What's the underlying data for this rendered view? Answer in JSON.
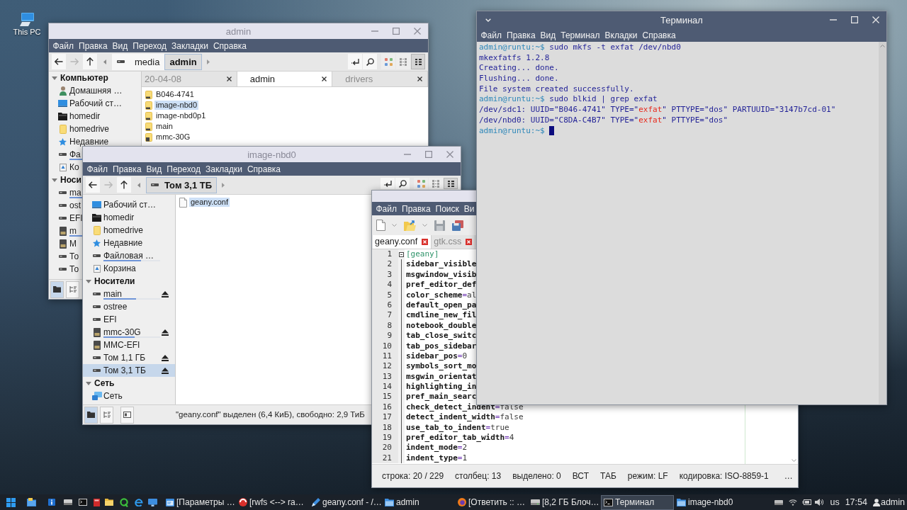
{
  "desktop_icons": [
    {
      "label": "This PC"
    }
  ],
  "windows": [
    {
      "kind": "file_manager",
      "title": "admin",
      "active": false,
      "menu": [
        "Файл",
        "Правка",
        "Вид",
        "Переход",
        "Закладки",
        "Справка"
      ],
      "nav": [
        {
          "kind": "back",
          "disabled": false
        },
        {
          "kind": "forward",
          "disabled": true
        },
        {
          "kind": "up",
          "disabled": false
        }
      ],
      "path": [
        {
          "kind": "root",
          "selected": false
        },
        {
          "kind": "folder",
          "label": "media",
          "selected": false
        },
        {
          "kind": "folder",
          "label": "admin",
          "selected": true
        }
      ],
      "view_modes": [
        {
          "kind": "icons",
          "selected": false
        },
        {
          "kind": "compact",
          "selected": false
        },
        {
          "kind": "details",
          "selected": true
        }
      ],
      "sidebar": [
        {
          "title": "Компьютер",
          "expanded": true,
          "children": [
            {
              "kind": "home",
              "label": "Домашняя …",
              "selected": false
            },
            {
              "kind": "desktop",
              "label": "Рабочий ст…",
              "selected": false
            },
            {
              "kind": "dark_folder",
              "label": "homedir",
              "selected": false
            },
            {
              "kind": "folder",
              "label": "homedrive",
              "selected": false
            },
            {
              "kind": "recent",
              "label": "Недавние",
              "selected": false
            },
            {
              "kind": "drive",
              "label": "Фа",
              "selected": false,
              "level": 0.66
            },
            {
              "kind": "trash",
              "label": "Ко",
              "selected": false
            }
          ]
        },
        {
          "title": "Носи",
          "expanded": true,
          "children": [
            {
              "kind": "drive",
              "label": "ma",
              "selected": false,
              "level": 0.58
            },
            {
              "kind": "drive",
              "label": "ost",
              "selected": false
            },
            {
              "kind": "drive",
              "label": "EFI",
              "selected": false
            },
            {
              "kind": "card",
              "label": "m",
              "selected": false,
              "level": 0.55
            },
            {
              "kind": "card",
              "label": "M",
              "selected": false
            },
            {
              "kind": "drive",
              "label": "То",
              "selected": false
            },
            {
              "kind": "drive",
              "label": "То",
              "selected": false
            }
          ]
        }
      ],
      "tabs": [
        {
          "label": "20-04-08",
          "selected": false
        },
        {
          "label": "admin",
          "selected": true
        },
        {
          "label": "drivers",
          "selected": false
        }
      ],
      "files": [
        {
          "kind": "mount",
          "name": "B046-4741",
          "selected": false
        },
        {
          "kind": "mount",
          "name": "image-nbd0",
          "selected": true
        },
        {
          "kind": "mount",
          "name": "image-nbd0p1",
          "selected": false
        },
        {
          "kind": "mount",
          "name": "main",
          "selected": false
        },
        {
          "kind": "card_mount",
          "name": "mmc-30G",
          "selected": false
        }
      ],
      "panel_buttons": [
        {
          "kind": "places",
          "selected": true
        },
        {
          "kind": "tree",
          "selected": false
        }
      ]
    },
    {
      "kind": "file_manager",
      "title": "image-nbd0",
      "active": false,
      "menu": [
        "Файл",
        "Правка",
        "Вид",
        "Переход",
        "Закладки",
        "Справка"
      ],
      "nav": [
        {
          "kind": "back",
          "disabled": false
        },
        {
          "kind": "forward",
          "disabled": true
        },
        {
          "kind": "up",
          "disabled": false
        }
      ],
      "path": [
        {
          "kind": "drive",
          "label": "Том 3,1 ТБ",
          "selected": true
        }
      ],
      "view_modes": [
        {
          "kind": "icons",
          "selected": false
        },
        {
          "kind": "compact",
          "selected": false
        },
        {
          "kind": "details",
          "selected": true
        }
      ],
      "sidebar": [
        {
          "children": [
            {
              "kind": "desktop",
              "label": "Рабочий ст…",
              "selected": false,
              "ejectable": false
            },
            {
              "kind": "dark_folder",
              "label": "homedir",
              "selected": false,
              "ejectable": false
            },
            {
              "kind": "folder",
              "label": "homedrive",
              "selected": false,
              "ejectable": false
            },
            {
              "kind": "recent",
              "label": "Недавние",
              "selected": false,
              "ejectable": false
            },
            {
              "kind": "drive",
              "label": "Файловая …",
              "selected": false,
              "ejectable": false,
              "level": 0.66
            },
            {
              "kind": "trash",
              "label": "Корзина",
              "selected": false,
              "ejectable": false
            }
          ]
        },
        {
          "title": "Носители",
          "expanded": true,
          "children": [
            {
              "kind": "drive",
              "label": "main",
              "selected": false,
              "ejectable": true,
              "level": 0.58
            },
            {
              "kind": "drive",
              "label": "ostree",
              "selected": false,
              "ejectable": false
            },
            {
              "kind": "drive",
              "label": "EFI",
              "selected": false,
              "ejectable": false
            },
            {
              "kind": "card",
              "label": "mmc-30G",
              "selected": false,
              "ejectable": true,
              "level": 0.55
            },
            {
              "kind": "card",
              "label": "MMC-EFI",
              "selected": false,
              "ejectable": false
            },
            {
              "kind": "drive",
              "label": "Том 1,1 ГБ",
              "selected": false,
              "ejectable": true
            },
            {
              "kind": "drive",
              "label": "Том 3,1 ТБ",
              "selected": true,
              "ejectable": true
            }
          ]
        },
        {
          "title": "Сеть",
          "expanded": true,
          "children": [
            {
              "kind": "network",
              "label": "Сеть",
              "selected": false,
              "ejectable": false
            }
          ]
        }
      ],
      "files": [
        {
          "kind": "text",
          "name": "geany.conf",
          "selected": true
        }
      ],
      "panel_buttons": [
        {
          "kind": "places",
          "selected": true
        },
        {
          "kind": "tree",
          "selected": false
        },
        {
          "kind": "panel",
          "selected": false
        }
      ],
      "status": "\"geany.conf\" выделен (6,4 КиБ), свободно: 2,9 ТиБ"
    },
    {
      "kind": "editor",
      "active": false,
      "menu": [
        "Файл",
        "Правка",
        "Поиск",
        "Ви"
      ],
      "toolbar": [
        {
          "kind": "new",
          "disabled": false
        },
        {
          "kind": "open",
          "disabled": false
        },
        {
          "kind": "save",
          "disabled": true
        },
        {
          "kind": "save_all",
          "disabled": false
        }
      ],
      "tabs": [
        {
          "label": "geany.conf",
          "selected": true
        },
        {
          "label": "gtk.css",
          "selected": false
        }
      ],
      "lines": [
        {
          "number": "1",
          "kind": "section",
          "text": "[geany]"
        },
        {
          "number": "2",
          "kind": "entry",
          "key": "sidebar_visible"
        },
        {
          "number": "3",
          "kind": "entry",
          "key": "msgwindow_visib"
        },
        {
          "number": "4",
          "kind": "entry",
          "key": "pref_editor_def"
        },
        {
          "number": "5",
          "kind": "entry",
          "key": "color_scheme",
          "operator": "=",
          "value": "al"
        },
        {
          "number": "6",
          "kind": "entry",
          "key": "default_open_pa"
        },
        {
          "number": "7",
          "kind": "entry",
          "key": "cmdline_new_fil"
        },
        {
          "number": "8",
          "kind": "entry",
          "key": "notebook_double"
        },
        {
          "number": "9",
          "kind": "entry",
          "key": "tab_close_switc"
        },
        {
          "number": "10",
          "kind": "entry",
          "key": "tab_pos_sidebar"
        },
        {
          "number": "11",
          "kind": "entry",
          "key": "sidebar_pos",
          "operator": "=",
          "value": "0"
        },
        {
          "number": "12",
          "kind": "entry",
          "key": "symbols_sort_mo"
        },
        {
          "number": "13",
          "kind": "entry",
          "key": "msgwin_orientat"
        },
        {
          "number": "14",
          "kind": "entry",
          "key": "highlighting_in"
        },
        {
          "number": "15",
          "kind": "entry",
          "key": "pref_main_searc"
        },
        {
          "number": "16",
          "kind": "entry",
          "key": "check_detect_indent",
          "operator": "=",
          "value": "false"
        },
        {
          "number": "17",
          "kind": "entry",
          "key": "detect_indent_width",
          "operator": "=",
          "value": "false"
        },
        {
          "number": "18",
          "kind": "entry",
          "key": "use_tab_to_indent",
          "operator": "=",
          "value": "true"
        },
        {
          "number": "19",
          "kind": "entry",
          "key": "pref_editor_tab_width",
          "operator": "=",
          "value": "4"
        },
        {
          "number": "20",
          "kind": "entry",
          "key": "indent_mode",
          "operator": "=",
          "value": "2"
        },
        {
          "number": "21",
          "kind": "entry",
          "key": "indent_type",
          "operator": "=",
          "value": "1"
        }
      ],
      "status": [
        "строка: 20 / 229",
        "столбец: 13",
        "выделено: 0",
        "ВСТ",
        "ТАБ",
        "режим: LF",
        "кодировка: ISO-8859-1",
        "…"
      ]
    },
    {
      "kind": "terminal",
      "title": "Терминал",
      "active": true,
      "menu": [
        "Файл",
        "Правка",
        "Вид",
        "Терминал",
        "Вкладки",
        "Справка"
      ],
      "lines": [
        {
          "segments": [
            {
              "kind": "prompt",
              "text": "admin@runtu:~$"
            },
            {
              "kind": "text",
              "text": " sudo mkfs -t exfat /dev/nbd0"
            }
          ],
          "cursor": false
        },
        {
          "segments": [
            {
              "kind": "text",
              "text": "mkexfatfs 1.2.8"
            }
          ],
          "cursor": false
        },
        {
          "segments": [
            {
              "kind": "text",
              "text": "Creating... done."
            }
          ],
          "cursor": false
        },
        {
          "segments": [
            {
              "kind": "text",
              "text": "Flushing... done."
            }
          ],
          "cursor": false
        },
        {
          "segments": [
            {
              "kind": "text",
              "text": "File system created successfully."
            }
          ],
          "cursor": false
        },
        {
          "segments": [
            {
              "kind": "prompt",
              "text": "admin@runtu:~$"
            },
            {
              "kind": "text",
              "text": " sudo blkid | grep exfat"
            }
          ],
          "cursor": false
        },
        {
          "segments": [
            {
              "kind": "text",
              "text": "/dev/sdc1: UUID=\"B046-4741\" TYPE=\""
            },
            {
              "kind": "match",
              "text": "exfat"
            },
            {
              "kind": "text",
              "text": "\" PTTYPE=\"dos\" PARTUUID=\"3147b7cd-01\""
            }
          ],
          "cursor": false
        },
        {
          "segments": [
            {
              "kind": "text",
              "text": "/dev/nbd0: UUID=\"C8DA-C4B7\" TYPE=\""
            },
            {
              "kind": "match",
              "text": "exfat"
            },
            {
              "kind": "text",
              "text": "\" PTTYPE=\"dos\""
            }
          ],
          "cursor": false
        },
        {
          "segments": [
            {
              "kind": "prompt",
              "text": "admin@runtu:~$"
            }
          ],
          "cursor": true
        }
      ]
    }
  ],
  "taskbar": {
    "tasks": [
      {
        "kind": "settings",
        "label": "[Параметры …",
        "selected": false
      },
      {
        "kind": "browser",
        "label": "[rwfs <--> ra…",
        "selected": false
      },
      {
        "kind": "editor",
        "label": "geany.conf - /…",
        "selected": false
      },
      {
        "kind": "files",
        "label": "admin",
        "selected": false
      },
      {
        "kind": "browser_alt",
        "label": "[Ответить :: …",
        "selected": false
      },
      {
        "kind": "disk",
        "label": "[8,2 ГБ Блоч…",
        "selected": false
      },
      {
        "kind": "terminal",
        "label": "Терминал",
        "selected": true
      },
      {
        "kind": "files",
        "label": "image-nbd0",
        "selected": false
      }
    ],
    "layout": "us",
    "clock": "17:54",
    "user": "admin"
  }
}
